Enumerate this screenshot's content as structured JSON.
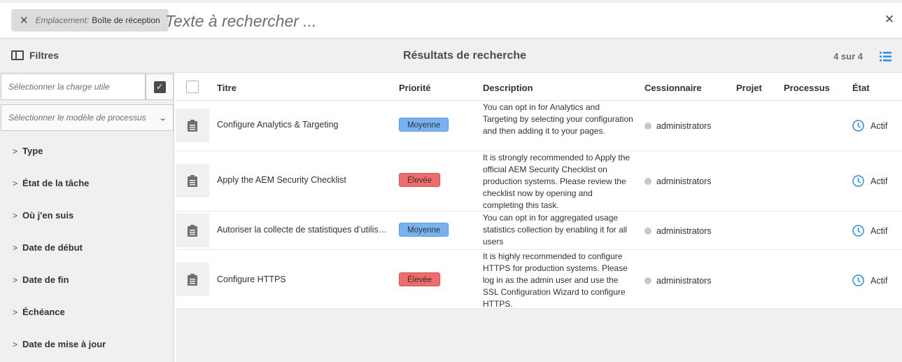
{
  "search": {
    "location_label": "Emplacement:",
    "location_value": "Boîte de réception",
    "placeholder": "Texte à rechercher ..."
  },
  "header": {
    "filters_label": "Filtres",
    "title": "Résultats de recherche",
    "count": "4 sur 4"
  },
  "sidebar": {
    "payload_placeholder": "Sélectionner la charge utile",
    "model_placeholder": "Sélectionner le modèle de processus",
    "facets": [
      "Type",
      "État de la tâche",
      "Où j'en suis",
      "Date de début",
      "Date de fin",
      "Échéance",
      "Date de mise à jour"
    ]
  },
  "table": {
    "columns": {
      "title": "Titre",
      "priority": "Priorité",
      "description": "Description",
      "assignee": "Cessionnaire",
      "project": "Projet",
      "process": "Processus",
      "status": "État"
    },
    "rows": [
      {
        "title": "Configure Analytics & Targeting",
        "priority": "Moyenne",
        "description": "You can opt in for Analytics and Targeting by selecting your configuration and then adding it to your pages.",
        "assignee": "administrators",
        "status": "Actif"
      },
      {
        "title": "Apply the AEM Security Checklist",
        "priority": "Élevée",
        "description": "It is strongly recommended to Apply the official AEM Security Checklist on production systems. Please review the checklist now by opening and completing this task.",
        "assignee": "administrators",
        "status": "Actif"
      },
      {
        "title": "Autoriser la collecte de statistiques d’utilisation agrégées",
        "priority": "Moyenne",
        "description": "You can opt in for aggregated usage statistics collection by enabling it for all users",
        "assignee": "administrators",
        "status": "Actif"
      },
      {
        "title": "Configure HTTPS",
        "priority": "Élevée",
        "description": "It is highly recommended to configure HTTPS for production systems. Please log in as the admin user and use the SSL Configuration Wizard to configure HTTPS.",
        "assignee": "administrators",
        "status": "Actif"
      }
    ]
  },
  "colors": {
    "priority_medium": "#78b3ef",
    "priority_high": "#ec6d6d",
    "status_icon": "#2d8ceb",
    "list_view_icon": "#2d8ceb"
  },
  "icons": {
    "close": "close-icon",
    "filters": "sidebar-toggle-icon",
    "list_view": "list-view-icon",
    "task": "clipboard-icon",
    "status": "clock-icon"
  }
}
